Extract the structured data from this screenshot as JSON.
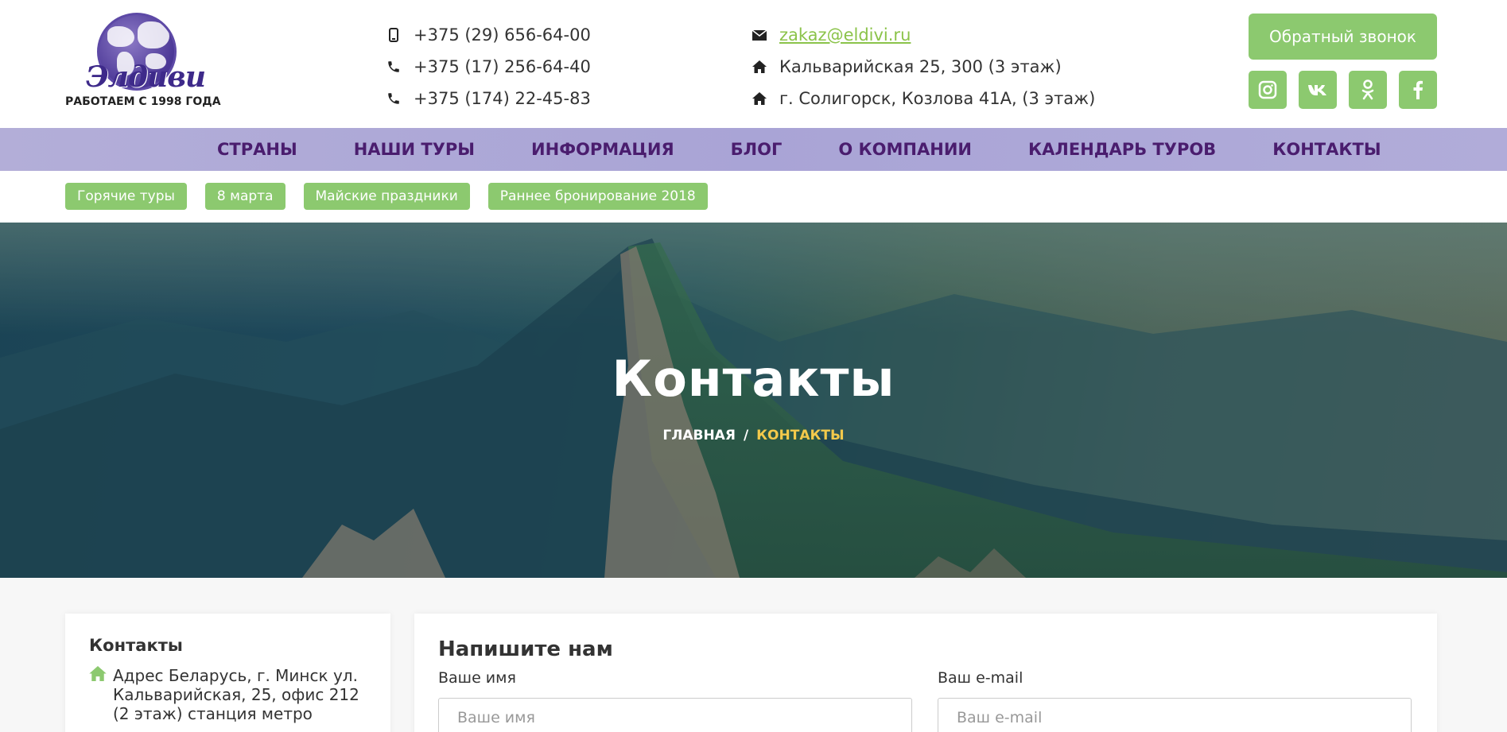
{
  "brand": {
    "logo_text": "Элдиви",
    "since": "РАБОТАЕМ С 1998 ГОДА"
  },
  "phones": [
    {
      "icon": "mobile-icon",
      "number": "+375 (29) 656-64-00"
    },
    {
      "icon": "phone-icon",
      "number": "+375 (17) 256-64-40"
    },
    {
      "icon": "phone-icon",
      "number": "+375 (174) 22-45-83"
    }
  ],
  "contacts": {
    "email": "zakaz@eldivi.ru",
    "address1": "Кальварийская 25, 300 (3 этаж)",
    "address2": "г. Солигорск, Козлова 41А, (3 этаж)"
  },
  "header": {
    "callback_label": "Обратный звонок",
    "socials": [
      "instagram-icon",
      "vk-icon",
      "odnoklassniki-icon",
      "facebook-icon"
    ],
    "social_glyphs": [
      "◎",
      "vk",
      "ok",
      "f"
    ]
  },
  "nav": {
    "items": [
      "СТРАНЫ",
      "НАШИ ТУРЫ",
      "ИНФОРМАЦИЯ",
      "БЛОГ",
      "О КОМПАНИИ",
      "КАЛЕНДАРЬ ТУРОВ",
      "КОНТАКТЫ"
    ]
  },
  "tags": [
    "Горячие туры",
    "8 марта",
    "Майские праздники",
    "Раннее бронирование 2018"
  ],
  "hero": {
    "title": "Контакты",
    "breadcrumb_home": "ГЛАВНАЯ",
    "breadcrumb_sep": "/",
    "breadcrumb_current": "КОНТАКТЫ"
  },
  "contacts_card": {
    "title": "Контакты",
    "address": "Адрес Беларусь, г. Минск ул. Кальварийская, 25, офис 212 (2 этаж) станция метро"
  },
  "form": {
    "title": "Напишите нам",
    "name_label": "Ваше имя",
    "name_placeholder": "Ваше имя",
    "email_label": "Ваш e-mail",
    "email_placeholder": "Ваш e-mail"
  },
  "colors": {
    "accent_green": "#8cc96f",
    "nav_bg": "#aaa5d6",
    "nav_text": "#4a1d6e",
    "breadcrumb_current": "#f3c94b"
  }
}
